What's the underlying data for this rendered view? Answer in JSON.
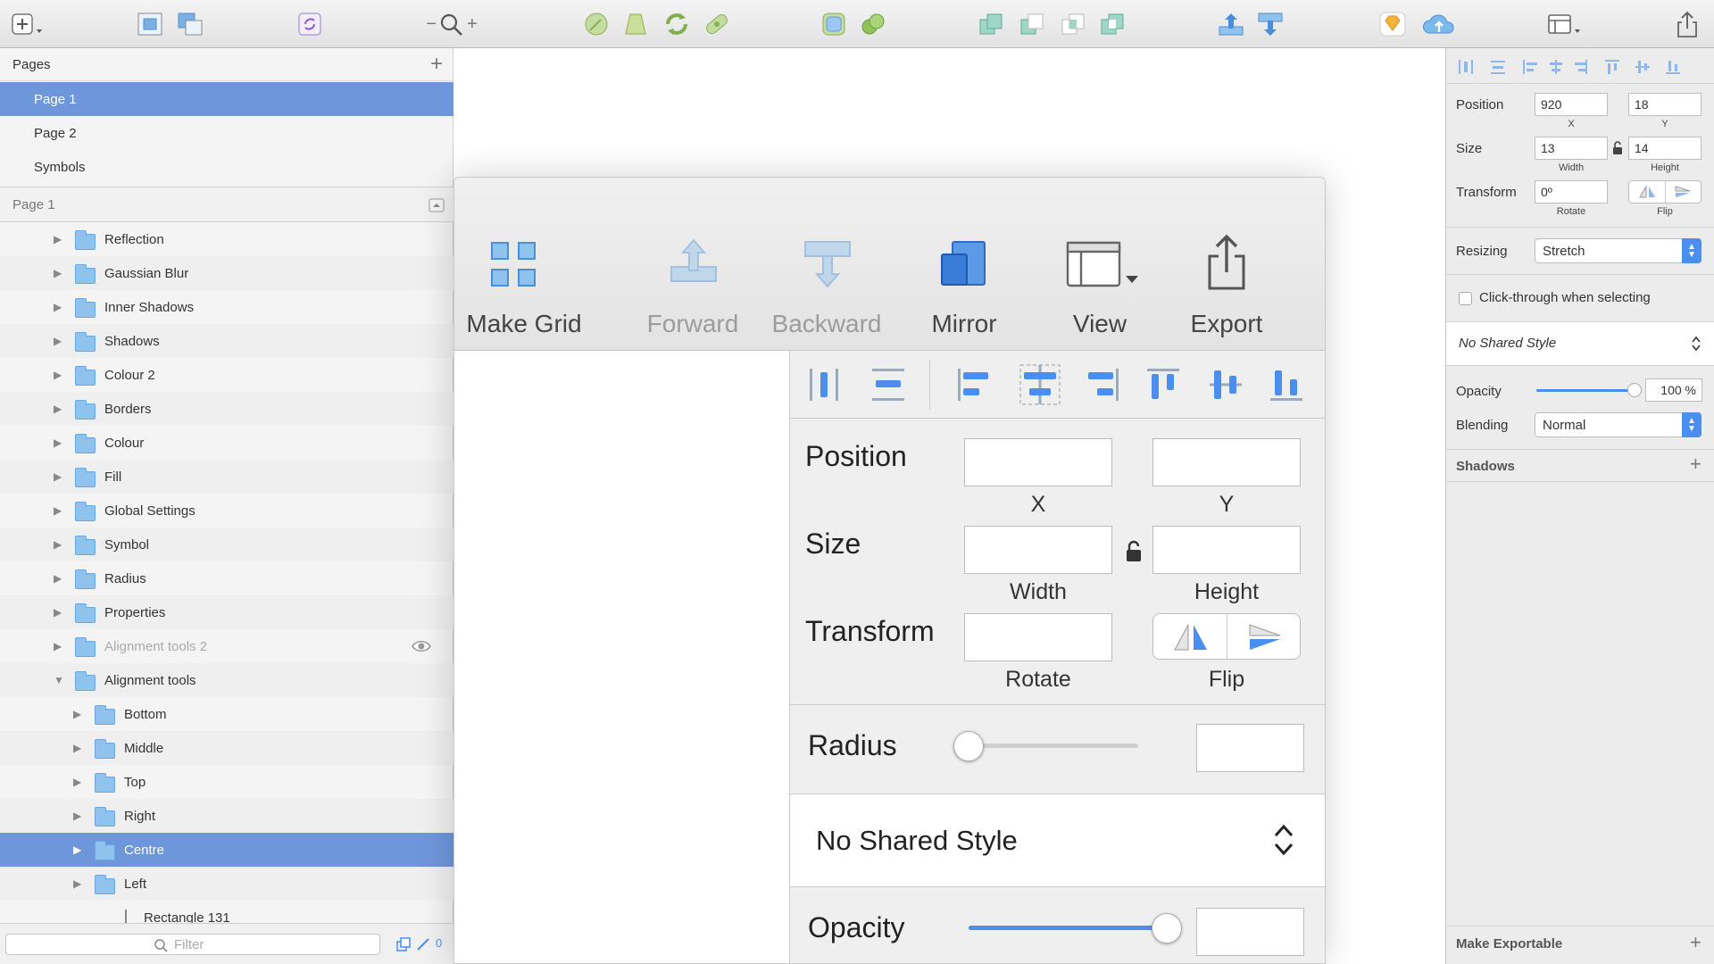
{
  "sidebar": {
    "pages_header": "Pages",
    "pages": [
      {
        "label": "Page 1",
        "selected": true
      },
      {
        "label": "Page 2",
        "selected": false
      },
      {
        "label": "Symbols",
        "selected": false
      }
    ],
    "layers_header": "Page 1",
    "layers": [
      {
        "label": "Reflection",
        "indent": 0,
        "expanded": false
      },
      {
        "label": "Gaussian Blur",
        "indent": 0,
        "expanded": false
      },
      {
        "label": "Inner Shadows",
        "indent": 0,
        "expanded": false
      },
      {
        "label": "Shadows",
        "indent": 0,
        "expanded": false
      },
      {
        "label": "Colour 2",
        "indent": 0,
        "expanded": false
      },
      {
        "label": "Borders",
        "indent": 0,
        "expanded": false
      },
      {
        "label": "Colour",
        "indent": 0,
        "expanded": false
      },
      {
        "label": "Fill",
        "indent": 0,
        "expanded": false
      },
      {
        "label": "Global Settings",
        "indent": 0,
        "expanded": false
      },
      {
        "label": "Symbol",
        "indent": 0,
        "expanded": false
      },
      {
        "label": "Radius",
        "indent": 0,
        "expanded": false
      },
      {
        "label": "Properties",
        "indent": 0,
        "expanded": false
      },
      {
        "label": "Alignment tools 2",
        "indent": 0,
        "expanded": false,
        "hidden": true
      },
      {
        "label": "Alignment tools",
        "indent": 0,
        "expanded": true
      },
      {
        "label": "Bottom",
        "indent": 1,
        "expanded": false
      },
      {
        "label": "Middle",
        "indent": 1,
        "expanded": false
      },
      {
        "label": "Top",
        "indent": 1,
        "expanded": false
      },
      {
        "label": "Right",
        "indent": 1,
        "expanded": false
      },
      {
        "label": "Centre",
        "indent": 1,
        "expanded": false,
        "selected": true
      },
      {
        "label": "Left",
        "indent": 1,
        "expanded": false
      },
      {
        "label": "Rectangle 131",
        "indent": 1,
        "shape": true
      }
    ],
    "filter_placeholder": "Filter",
    "footer_count": "0"
  },
  "inspector": {
    "position_label": "Position",
    "x_value": "920",
    "y_value": "18",
    "x_cap": "X",
    "y_cap": "Y",
    "size_label": "Size",
    "width_value": "13",
    "height_value": "14",
    "width_cap": "Width",
    "height_cap": "Height",
    "transform_label": "Transform",
    "rotate_value": "0º",
    "rotate_cap": "Rotate",
    "flip_cap": "Flip",
    "resizing_label": "Resizing",
    "resizing_value": "Stretch",
    "click_through_label": "Click-through when selecting",
    "shared_style": "No Shared Style",
    "opacity_label": "Opacity",
    "opacity_value": "100 %",
    "opacity_level": 1.0,
    "blending_label": "Blending",
    "blending_value": "Normal",
    "shadows_label": "Shadows",
    "make_exportable_label": "Make Exportable"
  },
  "zoom_panel": {
    "tools": [
      "Make Grid",
      "Forward",
      "Backward",
      "Mirror",
      "View",
      "Export"
    ],
    "position_label": "Position",
    "x_cap": "X",
    "y_cap": "Y",
    "size_label": "Size",
    "width_cap": "Width",
    "height_cap": "Height",
    "transform_label": "Transform",
    "rotate_cap": "Rotate",
    "flip_cap": "Flip",
    "radius_label": "Radius",
    "radius_level": 0.0,
    "shared_style": "No Shared Style",
    "opacity_label": "Opacity",
    "opacity_level": 1.0
  },
  "colors": {
    "selection": "#6e96db",
    "accent": "#4a8ef0",
    "folder": "#8fc2ec"
  }
}
